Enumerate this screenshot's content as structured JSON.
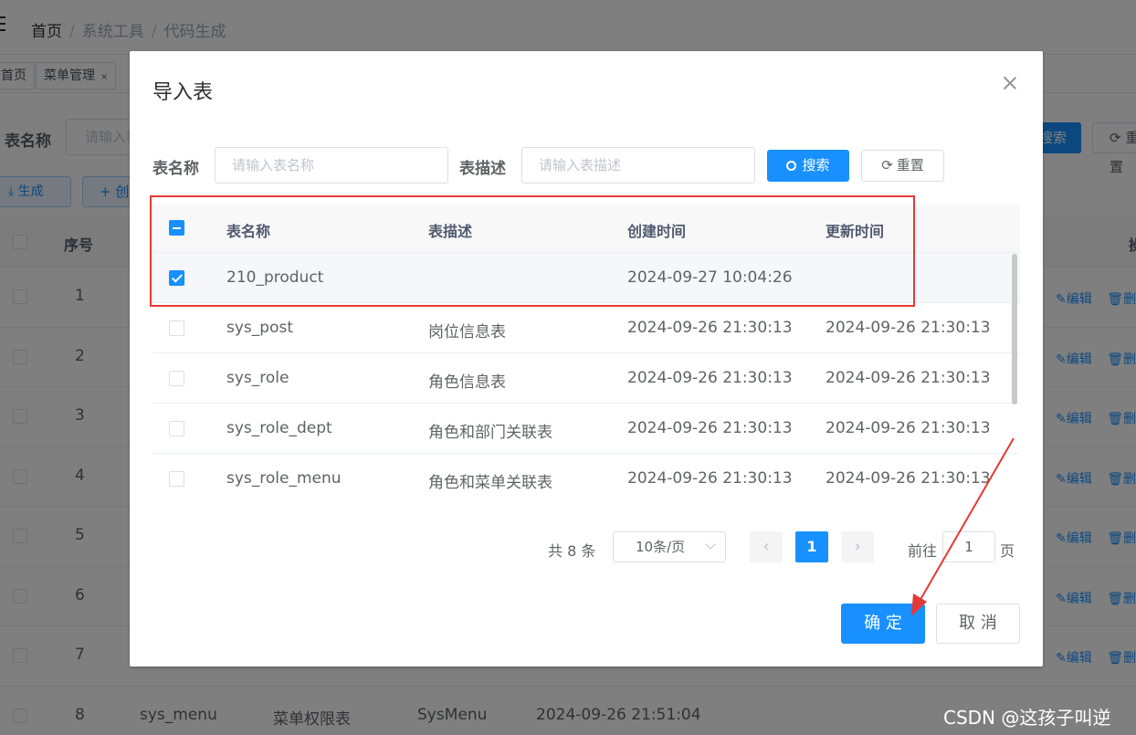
{
  "background": {
    "breadcrumb": [
      "首页",
      "系统工具",
      "代码生成"
    ],
    "tags": [
      {
        "label": "首页"
      },
      {
        "label": "菜单管理",
        "close": "×"
      }
    ],
    "search_label": "表名称",
    "search_placeholder": "请输入表名称",
    "search_button": "搜索",
    "reset_button": "重置",
    "generate_button": "生成",
    "create_button": "创",
    "columns": {
      "no": "序号",
      "op": "操"
    },
    "ops": {
      "edit": "编辑",
      "delete": "删"
    },
    "rows": [
      {
        "no": "1"
      },
      {
        "no": "2"
      },
      {
        "no": "3"
      },
      {
        "no": "4"
      },
      {
        "no": "5"
      },
      {
        "no": "6"
      },
      {
        "no": "7"
      },
      {
        "no": "8",
        "table": "sys_menu",
        "desc": "菜单权限表",
        "entity": "SysMenu",
        "created": "2024-09-26 21:51:04"
      }
    ]
  },
  "dialog": {
    "title": "导入表",
    "table_name_label": "表名称",
    "table_name_placeholder": "请输入表名称",
    "table_desc_label": "表描述",
    "table_desc_placeholder": "请输入表描述",
    "search_button": "搜索",
    "reset_button": "重置",
    "columns": [
      "表名称",
      "表描述",
      "创建时间",
      "更新时间"
    ],
    "rows": [
      {
        "checked": true,
        "name": "210_product",
        "desc": "",
        "created": "2024-09-27 10:04:26",
        "updated": ""
      },
      {
        "checked": false,
        "name": "sys_post",
        "desc": "岗位信息表",
        "created": "2024-09-26 21:30:13",
        "updated": "2024-09-26 21:30:13"
      },
      {
        "checked": false,
        "name": "sys_role",
        "desc": "角色信息表",
        "created": "2024-09-26 21:30:13",
        "updated": "2024-09-26 21:30:13"
      },
      {
        "checked": false,
        "name": "sys_role_dept",
        "desc": "角色和部门关联表",
        "created": "2024-09-26 21:30:13",
        "updated": "2024-09-26 21:30:13"
      },
      {
        "checked": false,
        "name": "sys_role_menu",
        "desc": "角色和菜单关联表",
        "created": "2024-09-26 21:30:13",
        "updated": "2024-09-26 21:30:13"
      }
    ],
    "pagination": {
      "total": "共 8 条",
      "page_size": "10条/页",
      "current_page": "1",
      "goto_label": "前往",
      "goto_value": "1",
      "page_label": "页"
    },
    "confirm_button": "确 定",
    "cancel_button": "取 消"
  },
  "watermark": "CSDN @这孩子叫逆",
  "colors": {
    "primary": "#1890ff",
    "annotation": "#e53935"
  }
}
